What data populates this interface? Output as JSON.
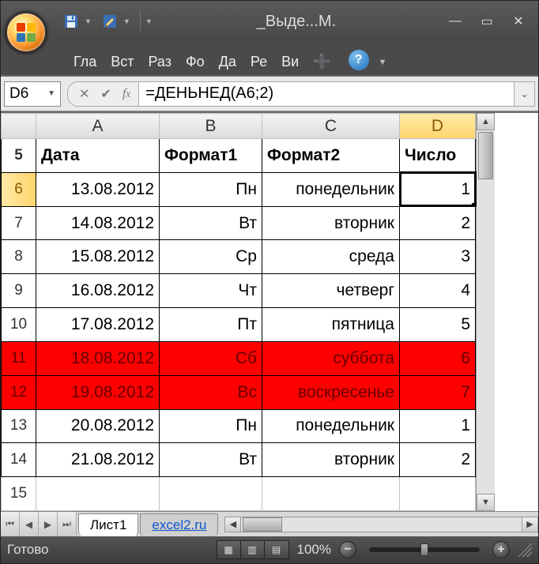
{
  "window": {
    "title": "_Выде...М.",
    "qat": {
      "save": "💾",
      "custom": "✎"
    }
  },
  "ribbon": {
    "tabs": [
      "Гла",
      "Вст",
      "Раз",
      "Фо",
      "Да",
      "Ре",
      "Ви"
    ],
    "add": "➕"
  },
  "namebox": "D6",
  "formula": "=ДЕНЬНЕД(A6;2)",
  "columns": [
    "A",
    "B",
    "C",
    "D"
  ],
  "selected_col_index": 3,
  "headers_row": 5,
  "headers": {
    "A": "Дата",
    "B": "Формат1",
    "C": "Формат2",
    "D": "Число"
  },
  "rows": [
    {
      "n": 6,
      "A": "13.08.2012",
      "B": "Пн",
      "C": "понедельник",
      "D": "1",
      "weekend": false,
      "active": true
    },
    {
      "n": 7,
      "A": "14.08.2012",
      "B": "Вт",
      "C": "вторник",
      "D": "2",
      "weekend": false
    },
    {
      "n": 8,
      "A": "15.08.2012",
      "B": "Ср",
      "C": "среда",
      "D": "3",
      "weekend": false
    },
    {
      "n": 9,
      "A": "16.08.2012",
      "B": "Чт",
      "C": "четверг",
      "D": "4",
      "weekend": false
    },
    {
      "n": 10,
      "A": "17.08.2012",
      "B": "Пт",
      "C": "пятница",
      "D": "5",
      "weekend": false
    },
    {
      "n": 11,
      "A": "18.08.2012",
      "B": "Сб",
      "C": "суббота",
      "D": "6",
      "weekend": true
    },
    {
      "n": 12,
      "A": "19.08.2012",
      "B": "Вс",
      "C": "воскресенье",
      "D": "7",
      "weekend": true
    },
    {
      "n": 13,
      "A": "20.08.2012",
      "B": "Пн",
      "C": "понедельник",
      "D": "1",
      "weekend": false
    },
    {
      "n": 14,
      "A": "21.08.2012",
      "B": "Вт",
      "C": "вторник",
      "D": "2",
      "weekend": false
    }
  ],
  "empty_row": 15,
  "sheets": {
    "active": "Лист1",
    "other": "excel2.ru"
  },
  "status": {
    "ready": "Готово",
    "zoom": "100%"
  }
}
